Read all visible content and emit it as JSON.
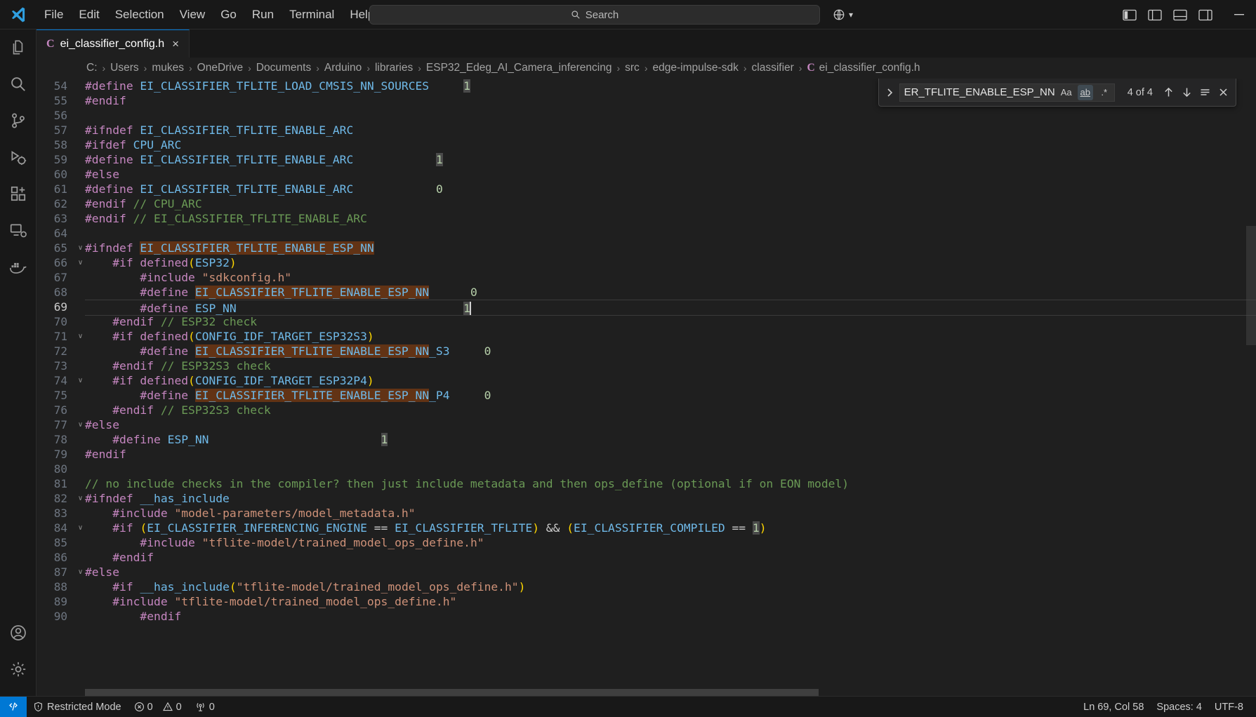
{
  "window": {
    "app": "Visual Studio Code",
    "menu": [
      "File",
      "Edit",
      "Selection",
      "View",
      "Go",
      "Run",
      "Terminal",
      "Help"
    ],
    "nav": {
      "back": "back-arrow",
      "forward": "forward-arrow"
    },
    "search_placeholder": "Search",
    "remote_label": "remote-indicator",
    "layout_buttons": [
      "toggle-primary-sidebar",
      "toggle-secondary-sidebar",
      "toggle-panel",
      "customize-layout"
    ],
    "window_controls": [
      "minimize"
    ]
  },
  "activitybar": {
    "items": [
      {
        "name": "explorer",
        "icon": "files-icon",
        "active": false
      },
      {
        "name": "search",
        "icon": "search-icon",
        "active": false
      },
      {
        "name": "source-control",
        "icon": "source-control-icon",
        "active": false
      },
      {
        "name": "run-and-debug",
        "icon": "run-debug-icon",
        "active": false
      },
      {
        "name": "extensions",
        "icon": "extensions-icon",
        "active": false
      },
      {
        "name": "remote-explorer",
        "icon": "remote-explorer-icon",
        "active": false
      },
      {
        "name": "docker",
        "icon": "docker-icon",
        "active": false
      }
    ],
    "bottom": [
      {
        "name": "accounts",
        "icon": "account-icon"
      },
      {
        "name": "manage",
        "icon": "gear-icon"
      }
    ]
  },
  "tab": {
    "file_icon_letter": "C",
    "label": "ei_classifier_config.h",
    "close": "×"
  },
  "breadcrumbs": {
    "separator": "›",
    "items": [
      "C:",
      "Users",
      "mukes",
      "OneDrive",
      "Documents",
      "Arduino",
      "libraries",
      "ESP32_Edeg_AI_Camera_inferencing",
      "src",
      "edge-impulse-sdk",
      "classifier"
    ],
    "file_icon_letter": "C",
    "file": "ei_classifier_config.h"
  },
  "find_widget": {
    "expand_icon": "chevron-right-icon",
    "query": "ER_TFLITE_ENABLE_ESP_NN",
    "match_case_label": "Aa",
    "whole_word_label": "ab",
    "regex_label": ".*",
    "match_count": "4 of 4",
    "previous_label": "↑",
    "next_label": "↓",
    "find_in_selection_label": "≡",
    "close_label": "✕"
  },
  "editor": {
    "first_line": 54,
    "active_line": 69,
    "lines": [
      {
        "n": 54,
        "fold": "",
        "tokens": [
          {
            "t": "#define ",
            "c": "t-pre"
          },
          {
            "t": "EI_CLASSIFIER_TFLITE_LOAD_CMSIS_NN_SOURCES",
            "c": "t-id"
          },
          {
            "t": "     ",
            "c": "t-plain"
          },
          {
            "t": "1",
            "c": "t-num hl-word"
          }
        ]
      },
      {
        "n": 55,
        "fold": "",
        "tokens": [
          {
            "t": "#endif",
            "c": "t-pre"
          }
        ]
      },
      {
        "n": 56,
        "fold": "",
        "tokens": []
      },
      {
        "n": 57,
        "fold": "",
        "tokens": [
          {
            "t": "#ifndef ",
            "c": "t-pre"
          },
          {
            "t": "EI_CLASSIFIER_TFLITE_ENABLE_ARC",
            "c": "t-id"
          }
        ]
      },
      {
        "n": 58,
        "fold": "",
        "tokens": [
          {
            "t": "#ifdef ",
            "c": "t-pre"
          },
          {
            "t": "CPU_ARC",
            "c": "t-id"
          }
        ]
      },
      {
        "n": 59,
        "fold": "",
        "tokens": [
          {
            "t": "#define ",
            "c": "t-pre"
          },
          {
            "t": "EI_CLASSIFIER_TFLITE_ENABLE_ARC",
            "c": "t-id"
          },
          {
            "t": "            ",
            "c": "t-plain"
          },
          {
            "t": "1",
            "c": "t-num hl-word"
          }
        ]
      },
      {
        "n": 60,
        "fold": "",
        "tokens": [
          {
            "t": "#else",
            "c": "t-pre"
          }
        ]
      },
      {
        "n": 61,
        "fold": "",
        "tokens": [
          {
            "t": "#define ",
            "c": "t-pre"
          },
          {
            "t": "EI_CLASSIFIER_TFLITE_ENABLE_ARC",
            "c": "t-id"
          },
          {
            "t": "            ",
            "c": "t-plain"
          },
          {
            "t": "0",
            "c": "t-num"
          }
        ]
      },
      {
        "n": 62,
        "fold": "",
        "tokens": [
          {
            "t": "#endif ",
            "c": "t-pre"
          },
          {
            "t": "// CPU_ARC",
            "c": "t-cmt"
          }
        ]
      },
      {
        "n": 63,
        "fold": "",
        "tokens": [
          {
            "t": "#endif ",
            "c": "t-pre"
          },
          {
            "t": "// EI_CLASSIFIER_TFLITE_ENABLE_ARC",
            "c": "t-cmt"
          }
        ]
      },
      {
        "n": 64,
        "fold": "",
        "tokens": []
      },
      {
        "n": 65,
        "fold": "v",
        "tokens": [
          {
            "t": "#ifndef ",
            "c": "t-pre"
          },
          {
            "t": "EI_CLASSIFIER_TFLITE_ENABLE_ESP_NN",
            "c": "t-id hl-find"
          }
        ]
      },
      {
        "n": 66,
        "fold": "v",
        "tokens": [
          {
            "t": "    ",
            "c": "t-plain"
          },
          {
            "t": "#if defined",
            "c": "t-pre"
          },
          {
            "t": "(",
            "c": "t-par"
          },
          {
            "t": "ESP32",
            "c": "t-id"
          },
          {
            "t": ")",
            "c": "t-par"
          }
        ]
      },
      {
        "n": 67,
        "fold": "",
        "tokens": [
          {
            "t": "        ",
            "c": "t-plain"
          },
          {
            "t": "#include ",
            "c": "t-pre"
          },
          {
            "t": "\"sdkconfig.h\"",
            "c": "t-str"
          }
        ]
      },
      {
        "n": 68,
        "fold": "",
        "tokens": [
          {
            "t": "        ",
            "c": "t-plain"
          },
          {
            "t": "#define ",
            "c": "t-pre"
          },
          {
            "t": "EI_CLASSIFIER_TFLITE_ENABLE_ESP_NN",
            "c": "t-id hl-find"
          },
          {
            "t": "      ",
            "c": "t-plain"
          },
          {
            "t": "0",
            "c": "t-num"
          }
        ]
      },
      {
        "n": 69,
        "fold": "",
        "tokens": [
          {
            "t": "        ",
            "c": "t-plain"
          },
          {
            "t": "#define ",
            "c": "t-pre"
          },
          {
            "t": "ESP_NN",
            "c": "t-id"
          },
          {
            "t": "                                 ",
            "c": "t-plain"
          },
          {
            "t": "1",
            "c": "t-num hl-word"
          }
        ]
      },
      {
        "n": 70,
        "fold": "",
        "tokens": [
          {
            "t": "    ",
            "c": "t-plain"
          },
          {
            "t": "#endif ",
            "c": "t-pre"
          },
          {
            "t": "// ESP32 check",
            "c": "t-cmt"
          }
        ]
      },
      {
        "n": 71,
        "fold": "v",
        "tokens": [
          {
            "t": "    ",
            "c": "t-plain"
          },
          {
            "t": "#if defined",
            "c": "t-pre"
          },
          {
            "t": "(",
            "c": "t-par"
          },
          {
            "t": "CONFIG_IDF_TARGET_ESP32S3",
            "c": "t-id"
          },
          {
            "t": ")",
            "c": "t-par"
          }
        ]
      },
      {
        "n": 72,
        "fold": "",
        "tokens": [
          {
            "t": "        ",
            "c": "t-plain"
          },
          {
            "t": "#define ",
            "c": "t-pre"
          },
          {
            "t": "EI_CLASSIFIER_TFLITE_ENABLE_ESP_NN",
            "c": "t-id hl-find"
          },
          {
            "t": "_S3",
            "c": "t-id"
          },
          {
            "t": "     ",
            "c": "t-plain"
          },
          {
            "t": "0",
            "c": "t-num"
          }
        ]
      },
      {
        "n": 73,
        "fold": "",
        "tokens": [
          {
            "t": "    ",
            "c": "t-plain"
          },
          {
            "t": "#endif ",
            "c": "t-pre"
          },
          {
            "t": "// ESP32S3 check",
            "c": "t-cmt"
          }
        ]
      },
      {
        "n": 74,
        "fold": "v",
        "tokens": [
          {
            "t": "    ",
            "c": "t-plain"
          },
          {
            "t": "#if defined",
            "c": "t-pre"
          },
          {
            "t": "(",
            "c": "t-par"
          },
          {
            "t": "CONFIG_IDF_TARGET_ESP32P4",
            "c": "t-id"
          },
          {
            "t": ")",
            "c": "t-par"
          }
        ]
      },
      {
        "n": 75,
        "fold": "",
        "tokens": [
          {
            "t": "        ",
            "c": "t-plain"
          },
          {
            "t": "#define ",
            "c": "t-pre"
          },
          {
            "t": "EI_CLASSIFIER_TFLITE_ENABLE_ESP_NN",
            "c": "t-id hl-find"
          },
          {
            "t": "_P4",
            "c": "t-id"
          },
          {
            "t": "     ",
            "c": "t-plain"
          },
          {
            "t": "0",
            "c": "t-num"
          }
        ]
      },
      {
        "n": 76,
        "fold": "",
        "tokens": [
          {
            "t": "    ",
            "c": "t-plain"
          },
          {
            "t": "#endif ",
            "c": "t-pre"
          },
          {
            "t": "// ESP32S3 check",
            "c": "t-cmt"
          }
        ]
      },
      {
        "n": 77,
        "fold": "v",
        "tokens": [
          {
            "t": "#else",
            "c": "t-pre"
          }
        ]
      },
      {
        "n": 78,
        "fold": "",
        "tokens": [
          {
            "t": "    ",
            "c": "t-plain"
          },
          {
            "t": "#define ",
            "c": "t-pre"
          },
          {
            "t": "ESP_NN",
            "c": "t-id"
          },
          {
            "t": "                         ",
            "c": "t-plain"
          },
          {
            "t": "1",
            "c": "t-num hl-word"
          }
        ]
      },
      {
        "n": 79,
        "fold": "",
        "tokens": [
          {
            "t": "#endif",
            "c": "t-pre"
          }
        ]
      },
      {
        "n": 80,
        "fold": "",
        "tokens": []
      },
      {
        "n": 81,
        "fold": "",
        "tokens": [
          {
            "t": "// no include checks in the compiler? then just include metadata and then ops_define (optional if on EON model)",
            "c": "t-cmt"
          }
        ]
      },
      {
        "n": 82,
        "fold": "v",
        "tokens": [
          {
            "t": "#ifndef ",
            "c": "t-pre"
          },
          {
            "t": "__has_include",
            "c": "t-id"
          }
        ]
      },
      {
        "n": 83,
        "fold": "",
        "tokens": [
          {
            "t": "    ",
            "c": "t-plain"
          },
          {
            "t": "#include ",
            "c": "t-pre"
          },
          {
            "t": "\"model-parameters/model_metadata.h\"",
            "c": "t-str"
          }
        ]
      },
      {
        "n": 84,
        "fold": "v",
        "tokens": [
          {
            "t": "    ",
            "c": "t-plain"
          },
          {
            "t": "#if ",
            "c": "t-pre"
          },
          {
            "t": "(",
            "c": "t-par"
          },
          {
            "t": "EI_CLASSIFIER_INFERENCING_ENGINE",
            "c": "t-id"
          },
          {
            "t": " == ",
            "c": "t-op"
          },
          {
            "t": "EI_CLASSIFIER_TFLITE",
            "c": "t-id"
          },
          {
            "t": ")",
            "c": "t-par"
          },
          {
            "t": " && ",
            "c": "t-op"
          },
          {
            "t": "(",
            "c": "t-par"
          },
          {
            "t": "EI_CLASSIFIER_COMPILED",
            "c": "t-id"
          },
          {
            "t": " == ",
            "c": "t-op"
          },
          {
            "t": "1",
            "c": "t-num hl-word"
          },
          {
            "t": ")",
            "c": "t-par"
          }
        ]
      },
      {
        "n": 85,
        "fold": "",
        "tokens": [
          {
            "t": "        ",
            "c": "t-plain"
          },
          {
            "t": "#include ",
            "c": "t-pre"
          },
          {
            "t": "\"tflite-model/trained_model_ops_define.h\"",
            "c": "t-str"
          }
        ]
      },
      {
        "n": 86,
        "fold": "",
        "tokens": [
          {
            "t": "    ",
            "c": "t-plain"
          },
          {
            "t": "#endif",
            "c": "t-pre"
          }
        ]
      },
      {
        "n": 87,
        "fold": "v",
        "tokens": [
          {
            "t": "#else",
            "c": "t-pre"
          }
        ]
      },
      {
        "n": 88,
        "fold": "",
        "tokens": [
          {
            "t": "    ",
            "c": "t-plain"
          },
          {
            "t": "#if ",
            "c": "t-pre"
          },
          {
            "t": "__has_include",
            "c": "t-id"
          },
          {
            "t": "(",
            "c": "t-par"
          },
          {
            "t": "\"tflite-model/trained_model_ops_define.h\"",
            "c": "t-str"
          },
          {
            "t": ")",
            "c": "t-par"
          }
        ]
      },
      {
        "n": 89,
        "fold": "",
        "tokens": [
          {
            "t": "    ",
            "c": "t-plain"
          },
          {
            "t": "#include ",
            "c": "t-pre"
          },
          {
            "t": "\"tflite-model/trained_model_ops_define.h\"",
            "c": "t-str"
          }
        ]
      },
      {
        "n": 90,
        "fold": "",
        "tokens": [
          {
            "t": "        ",
            "c": "t-plain"
          },
          {
            "t": "#endif",
            "c": "t-pre"
          }
        ]
      }
    ]
  },
  "statusbar": {
    "remote_label": "remote-window-icon",
    "restricted_mode": "Restricted Mode",
    "errors": "0",
    "warnings": "0",
    "ports": "0",
    "position": "Ln 69, Col 58",
    "indentation": "Spaces: 4",
    "encoding": "UTF-8"
  },
  "colors": {
    "accent": "#0078d4",
    "editor_bg": "#1f1f1f",
    "chrome_bg": "#181818",
    "find_match_highlight": "#623315",
    "word_highlight": "#4a4a4a"
  }
}
